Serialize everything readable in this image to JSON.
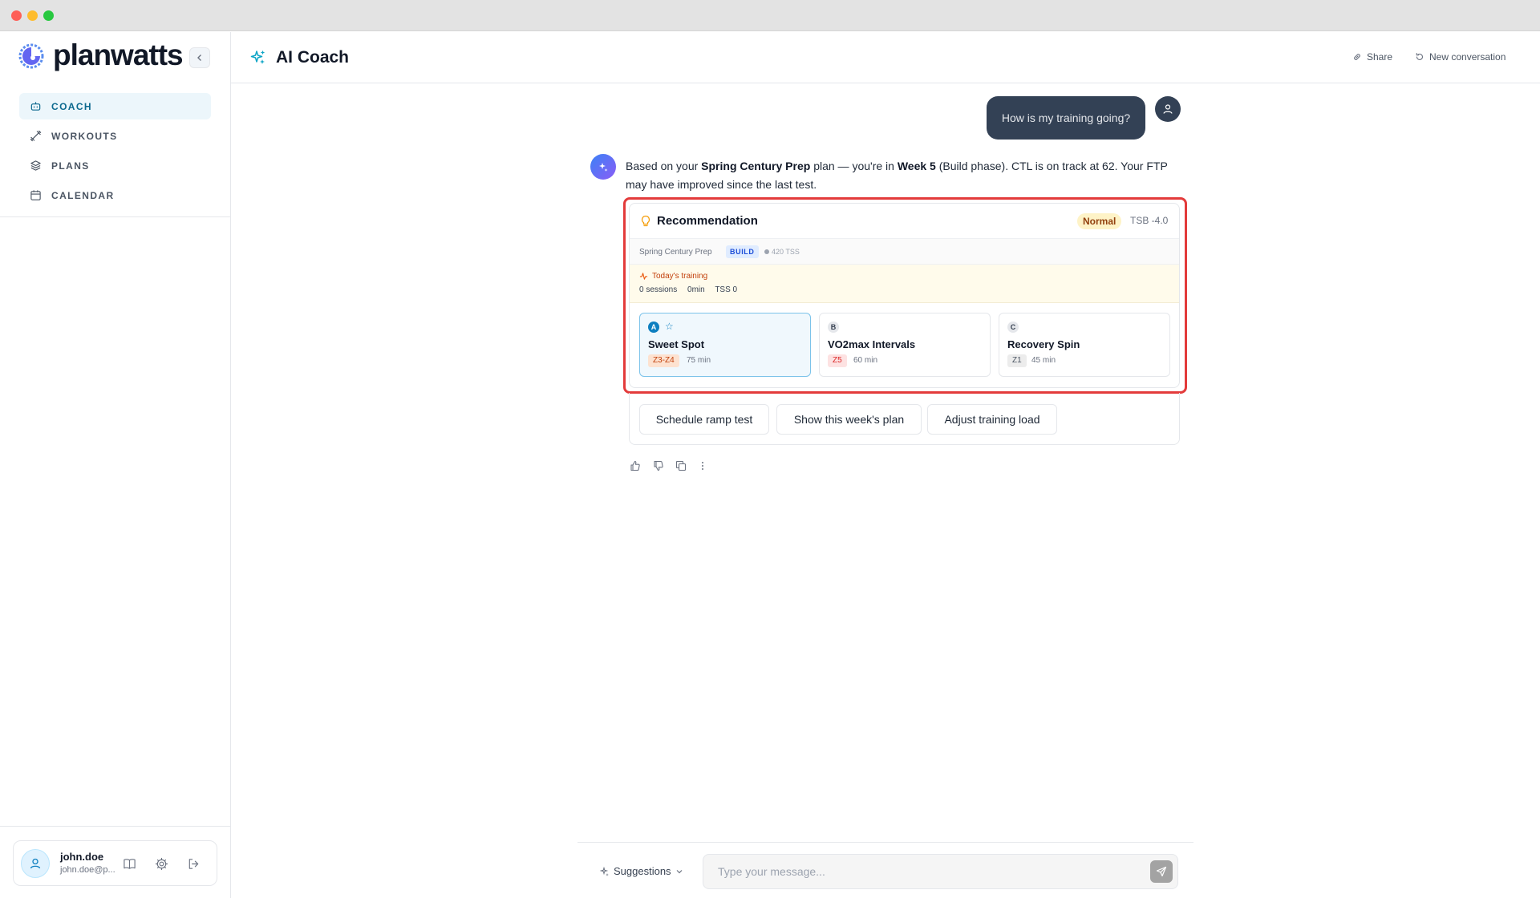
{
  "brand": {
    "name": "planwatts"
  },
  "sidebar": {
    "items": [
      {
        "label": "COACH",
        "icon": "robot-icon",
        "active": true
      },
      {
        "label": "WORKOUTS",
        "icon": "dumbbell-icon",
        "active": false
      },
      {
        "label": "PLANS",
        "icon": "layers-icon",
        "active": false
      },
      {
        "label": "CALENDAR",
        "icon": "calendar-icon",
        "active": false
      }
    ],
    "user": {
      "name": "john.doe",
      "email": "john.doe@p..."
    }
  },
  "header": {
    "title": "AI Coach",
    "share_label": "Share",
    "new_conversation_label": "New conversation"
  },
  "chat": {
    "user_message": "How is my training going?",
    "bot_message": {
      "p1": "Based on your ",
      "plan_name": "Spring Century Prep",
      "p2": " plan — you're in ",
      "week": "Week 5",
      "p3": " (Build phase). CTL is on track at 62. Your FTP may have improved since the last test."
    },
    "recommendation": {
      "title": "Recommendation",
      "status": "Normal",
      "tsb": "TSB -4.0",
      "plan": "Spring Century Prep",
      "phase": "BUILD",
      "weekly_tss": "420 TSS",
      "today_label": "Today's training",
      "today_sessions": "0 sessions",
      "today_duration": "0min",
      "today_tss": "TSS 0",
      "options": [
        {
          "letter": "A",
          "name": "Sweet Spot",
          "zone": "Z3-Z4",
          "duration": "75 min",
          "selected": true,
          "zone_color": "#fde2d0",
          "zone_text": "#c2410c"
        },
        {
          "letter": "B",
          "name": "VO2max Intervals",
          "zone": "Z5",
          "duration": "60 min",
          "selected": false,
          "zone_color": "#fde2e2",
          "zone_text": "#dc2626"
        },
        {
          "letter": "C",
          "name": "Recovery Spin",
          "zone": "Z1",
          "duration": "45 min",
          "selected": false,
          "zone_color": "#ececec",
          "zone_text": "#4b5563"
        }
      ]
    },
    "quick_actions": [
      "Schedule ramp test",
      "Show this week's plan",
      "Adjust training load"
    ]
  },
  "composer": {
    "suggestions_label": "Suggestions",
    "placeholder": "Type your message..."
  },
  "colors": {
    "accent": "#0e7fc0",
    "active_nav_bg": "#ecf6fb",
    "highlight_border": "#e33b3b"
  }
}
